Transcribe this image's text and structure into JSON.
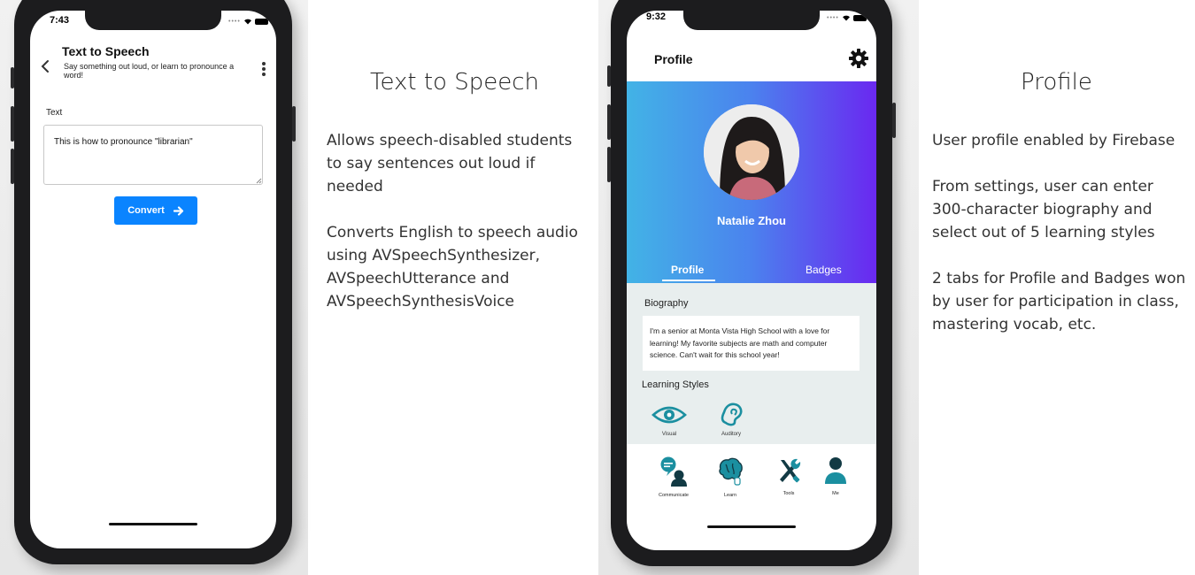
{
  "left_phone": {
    "status_time": "7:43",
    "title": "Text to Speech",
    "subtitle": "Say something out loud, or learn to pronounce a word!",
    "field_label": "Text",
    "text_value": "This is how to pronounce \"librarian\"",
    "convert_label": "Convert"
  },
  "left_caption": {
    "title": "Text to Speech",
    "p1": "Allows speech-disabled students to say sentences out loud if needed",
    "p2": "Converts English to speech audio using AVSpeechSynthesizer, AVSpeechUtterance and AVSpeechSynthesisVoice"
  },
  "right_phone": {
    "status_time": "9:32",
    "header": "Profile",
    "user_name": "Natalie Zhou",
    "tabs": [
      {
        "label": "Profile",
        "active": true
      },
      {
        "label": "Badges",
        "active": false
      }
    ],
    "biography_label": "Biography",
    "biography_text": "I'm a senior at Monta Vista High School with a love for learning! My favorite subjects are math and computer science. Can't wait for this school year!",
    "learning_styles_label": "Learning Styles",
    "learning_styles": [
      {
        "label": "Visual",
        "icon": "eye-icon"
      },
      {
        "label": "Auditory",
        "icon": "ear-icon"
      }
    ],
    "tab_bar": [
      {
        "label": "Communicate",
        "icon": "communicate-icon"
      },
      {
        "label": "Learn",
        "icon": "brain-icon"
      },
      {
        "label": "Tools",
        "icon": "tools-icon"
      },
      {
        "label": "Me",
        "icon": "person-icon"
      }
    ]
  },
  "right_caption": {
    "title": "Profile",
    "p1": "User profile enabled by Firebase",
    "p2": "From settings, user can enter 300-character biography and select out of 5 learning styles",
    "p3": "2 tabs for Profile and Badges won by user for participation in class, mastering vocab, etc."
  },
  "colors": {
    "accent_blue": "#0a84ff",
    "gradient_start": "#42b3e6",
    "gradient_end": "#6a28f0",
    "teal_icon": "#1b8fa0"
  }
}
